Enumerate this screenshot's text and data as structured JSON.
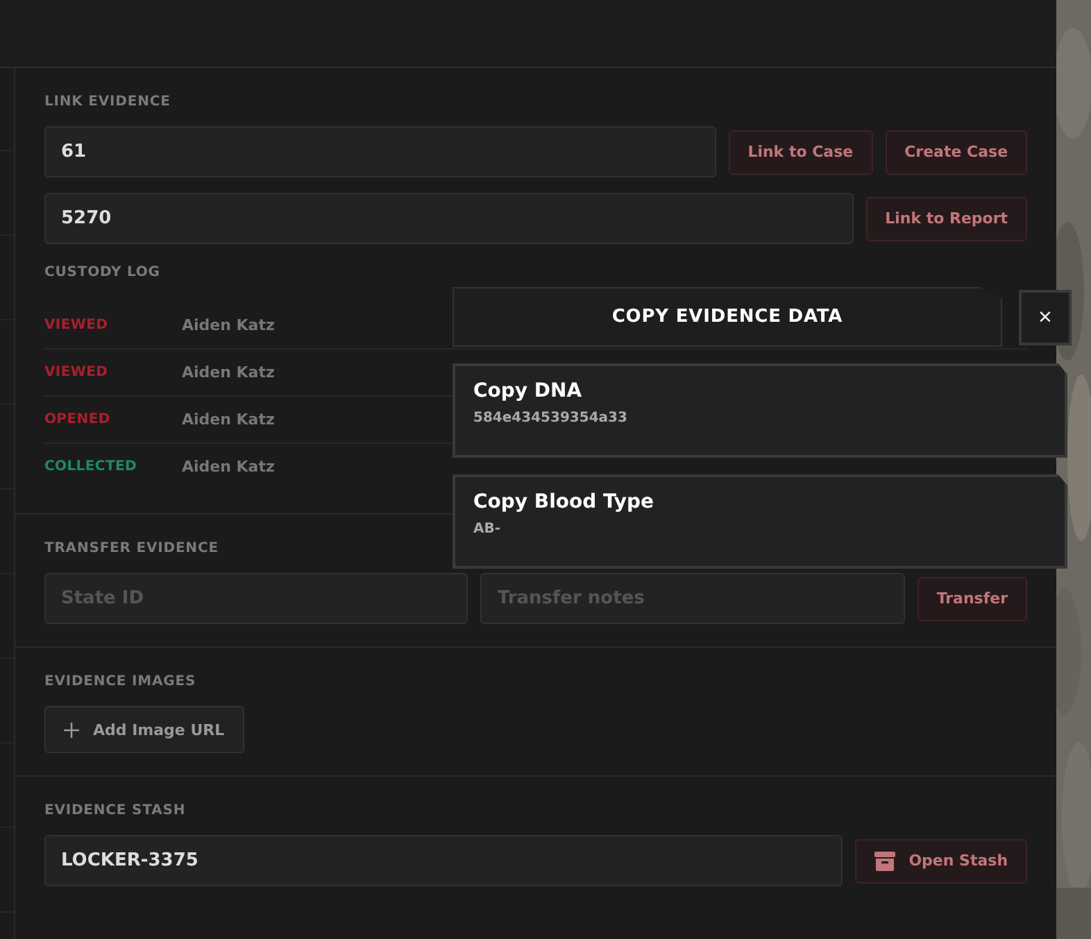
{
  "link_evidence": {
    "heading": "LINK EVIDENCE",
    "case_field": {
      "value": "61"
    },
    "report_field": {
      "value": "5270"
    },
    "buttons": [
      {
        "label": "Link to Case"
      },
      {
        "label": "Create Case"
      }
    ],
    "report_button": {
      "label": "Link to Report"
    }
  },
  "custody_log": {
    "heading": "CUSTODY LOG",
    "entries": [
      {
        "action": "VIEWED",
        "color": "#a8202c",
        "person": "Aiden Katz"
      },
      {
        "action": "VIEWED",
        "color": "#a8202c",
        "person": "Aiden Katz"
      },
      {
        "action": "OPENED",
        "color": "#a8202c",
        "person": "Aiden Katz"
      },
      {
        "action": "COLLECTED",
        "color": "#1f8a5c",
        "person": "Aiden Katz"
      }
    ]
  },
  "transfer_evidence": {
    "heading": "TRANSFER EVIDENCE",
    "fields": [
      {
        "placeholder": "State ID"
      },
      {
        "placeholder": "Transfer notes"
      }
    ],
    "button": {
      "label": "Transfer"
    }
  },
  "evidence_images": {
    "heading": "EVIDENCE IMAGES",
    "button": {
      "label": "Add Image URL"
    }
  },
  "evidence_stash": {
    "heading": "EVIDENCE STASH",
    "field": {
      "value": "LOCKER-3375"
    },
    "button": {
      "label": "Open Stash"
    }
  },
  "copy_popup": {
    "title": "COPY EVIDENCE DATA",
    "close": "×",
    "items": [
      {
        "label": "Copy DNA",
        "value": "584e434539354a33"
      },
      {
        "label": "Copy Blood Type",
        "value": "AB-"
      }
    ]
  }
}
